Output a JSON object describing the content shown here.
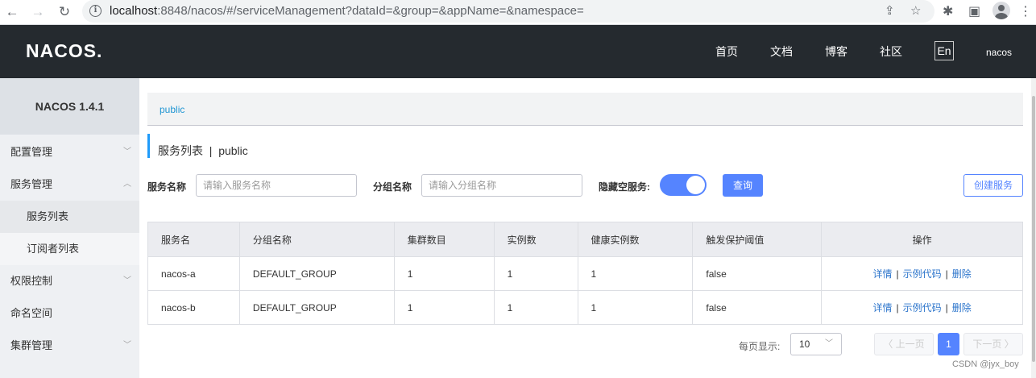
{
  "browser": {
    "url_host": "localhost",
    "url_rest": ":8848/nacos/#/serviceManagement?dataId=&group=&appName=&namespace="
  },
  "header": {
    "logo": "NACOS.",
    "nav": [
      "首页",
      "文档",
      "博客",
      "社区"
    ],
    "lang": "En",
    "user": "nacos"
  },
  "sidebar": {
    "version": "NACOS 1.4.1",
    "items": [
      {
        "label": "配置管理",
        "arrow": "﹀"
      },
      {
        "label": "服务管理",
        "arrow": "︿"
      },
      {
        "label": "服务列表"
      },
      {
        "label": "订阅者列表"
      },
      {
        "label": "权限控制",
        "arrow": "﹀"
      },
      {
        "label": "命名空间"
      },
      {
        "label": "集群管理",
        "arrow": "﹀"
      }
    ]
  },
  "breadcrumb": "public",
  "page_title": "服务列表  |  public",
  "filters": {
    "service_name_label": "服务名称",
    "service_name_placeholder": "请输入服务名称",
    "group_name_label": "分组名称",
    "group_name_placeholder": "请输入分组名称",
    "hide_empty_label": "隐藏空服务:",
    "hide_empty_on": true,
    "query_button": "查询",
    "create_button": "创建服务"
  },
  "table": {
    "headers": [
      "服务名",
      "分组名称",
      "集群数目",
      "实例数",
      "健康实例数",
      "触发保护阈值",
      "操作"
    ],
    "rows": [
      {
        "name": "nacos-a",
        "group": "DEFAULT_GROUP",
        "clusters": "1",
        "instances": "1",
        "healthy": "1",
        "threshold": "false"
      },
      {
        "name": "nacos-b",
        "group": "DEFAULT_GROUP",
        "clusters": "1",
        "instances": "1",
        "healthy": "1",
        "threshold": "false"
      }
    ],
    "actions": [
      "详情",
      "示例代码",
      "删除"
    ]
  },
  "pagination": {
    "per_page_label": "每页显示:",
    "per_page": "10",
    "prev": "上一页",
    "current": "1",
    "next": "下一页"
  },
  "watermark": "CSDN @jyx_boy",
  "colors": {
    "header_bg": "#252a2f",
    "primary": "#5584ff",
    "link": "#2e76cc"
  }
}
